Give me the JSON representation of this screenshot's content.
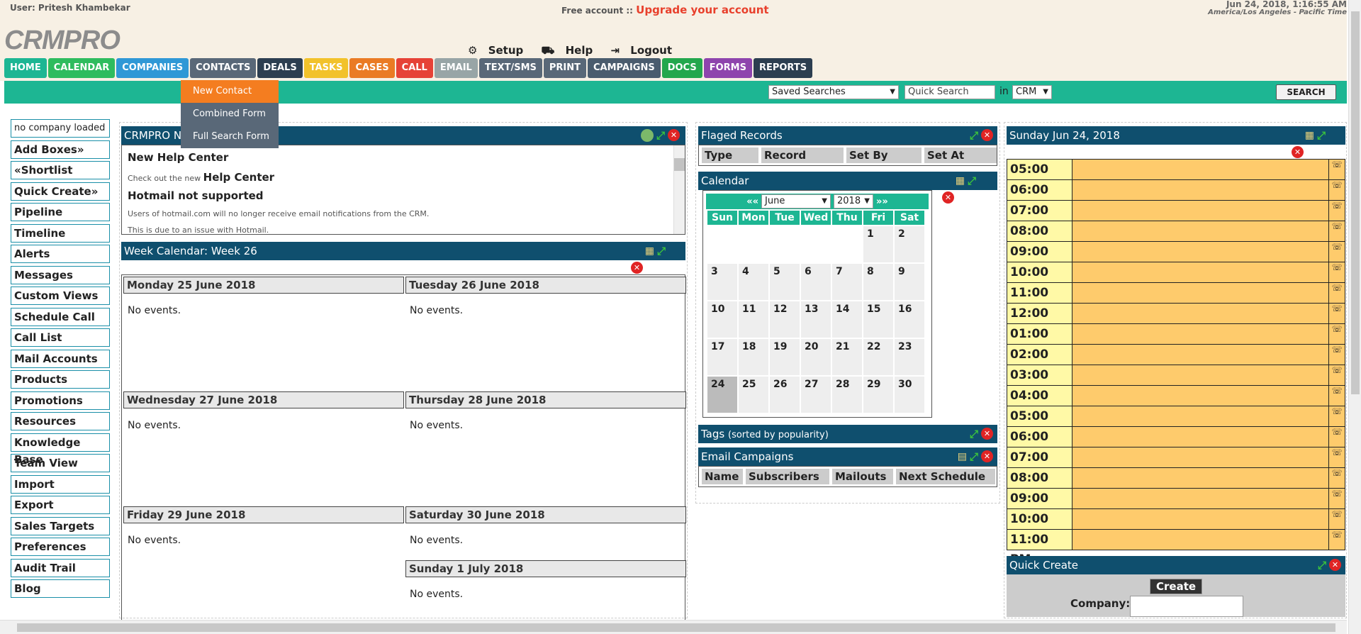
{
  "header": {
    "user": "User: Pritesh Khambekar",
    "free": "Free account ::",
    "upgrade": "Upgrade your account",
    "datetime": "Jun 24, 2018, 1:16:55 AM",
    "timezone": "America/Los Angeles - Pacific Time",
    "logo": "CRMPRO",
    "setup": "Setup",
    "help": "Help",
    "logout": "Logout"
  },
  "nav": [
    {
      "label": "HOME",
      "color": "#1db693"
    },
    {
      "label": "CALENDAR",
      "color": "#2ebc5e"
    },
    {
      "label": "COMPANIES",
      "color": "#2f98d6"
    },
    {
      "label": "CONTACTS",
      "color": "#596878"
    },
    {
      "label": "DEALS",
      "color": "#2c3e50"
    },
    {
      "label": "TASKS",
      "color": "#f2c22a"
    },
    {
      "label": "CASES",
      "color": "#ea7b24"
    },
    {
      "label": "CALL",
      "color": "#e64237"
    },
    {
      "label": "EMAIL",
      "color": "#98a5a6"
    },
    {
      "label": "TEXT/SMS",
      "color": "#596878"
    },
    {
      "label": "PRINT",
      "color": "#596878"
    },
    {
      "label": "CAMPAIGNS",
      "color": "#4a5c6e"
    },
    {
      "label": "DOCS",
      "color": "#23a74d"
    },
    {
      "label": "FORMS",
      "color": "#8e44ad"
    },
    {
      "label": "REPORTS",
      "color": "#2c3e50"
    }
  ],
  "contacts_menu": [
    "New Contact",
    "Combined Form",
    "Full Search Form"
  ],
  "search": {
    "saved": "Saved Searches",
    "quick": "Quick Search",
    "in": "in",
    "scope": "CRM",
    "button": "SEARCH"
  },
  "sidebar": [
    "no company loaded",
    "Add Boxes»",
    "«Shortlist",
    "Quick Create»",
    "Pipeline",
    "Timeline",
    "Alerts",
    "Messages",
    "Custom Views",
    "Schedule Call",
    "Call List",
    "Mail Accounts",
    "Products",
    "Promotions",
    "Resources",
    "Knowledge Base",
    "Team View",
    "Import",
    "Export",
    "Sales Targets",
    "Preferences",
    "Audit Trail",
    "Blog"
  ],
  "news": {
    "title": "CRMPRO N",
    "h1": "New Help Center",
    "p1a": "Check out the new",
    "p1b": "Help Center",
    "h2": "Hotmail not supported",
    "p2": "Users of hotmail.com will no longer receive email notifications from the CRM.",
    "p3": "This is due to an issue with Hotmail."
  },
  "week": {
    "title": "Week Calendar: Week 26",
    "none": "No events.",
    "days": [
      "Monday 25 June 2018",
      "Tuesday 26 June 2018",
      "Wednesday 27 June 2018",
      "Thursday 28 June 2018",
      "Friday 29 June 2018",
      "Saturday 30 June 2018",
      "Sunday 1 July 2018"
    ]
  },
  "flagged": {
    "title": "Flaged Records",
    "cols": [
      "Type",
      "Record",
      "Set By",
      "Set At"
    ]
  },
  "calendar": {
    "title": "Calendar",
    "prev": "«« ",
    "month": "June",
    "year": "2018",
    "next": "»»",
    "dows": [
      "Sun",
      "Mon",
      "Tue",
      "Wed",
      "Thu",
      "Fri",
      "Sat"
    ],
    "weeks": [
      [
        "",
        "",
        "",
        "",
        "",
        "1",
        "2"
      ],
      [
        "3",
        "4",
        "5",
        "6",
        "7",
        "8",
        "9"
      ],
      [
        "10",
        "11",
        "12",
        "13",
        "14",
        "15",
        "16"
      ],
      [
        "17",
        "18",
        "19",
        "20",
        "21",
        "22",
        "23"
      ],
      [
        "24",
        "25",
        "26",
        "27",
        "28",
        "29",
        "30"
      ]
    ]
  },
  "tags": {
    "title": "Tags",
    "sub": "(sorted by popularity)"
  },
  "campaigns": {
    "title": "Email Campaigns",
    "cols": [
      "Name",
      "Subscribers",
      "Mailouts",
      "Next Schedule"
    ]
  },
  "day": {
    "title": "Sunday Jun 24, 2018",
    "slots": [
      "05:00 AM",
      "06:00 AM",
      "07:00 AM",
      "08:00 AM",
      "09:00 AM",
      "10:00 AM",
      "11:00 AM",
      "12:00 PM",
      "01:00 PM",
      "02:00 PM",
      "03:00 PM",
      "04:00 PM",
      "05:00 PM",
      "06:00 PM",
      "07:00 PM",
      "08:00 PM",
      "09:00 PM",
      "10:00 PM",
      "11:00 PM"
    ]
  },
  "quick": {
    "title": "Quick Create",
    "create": "Create",
    "company": "Company:"
  }
}
